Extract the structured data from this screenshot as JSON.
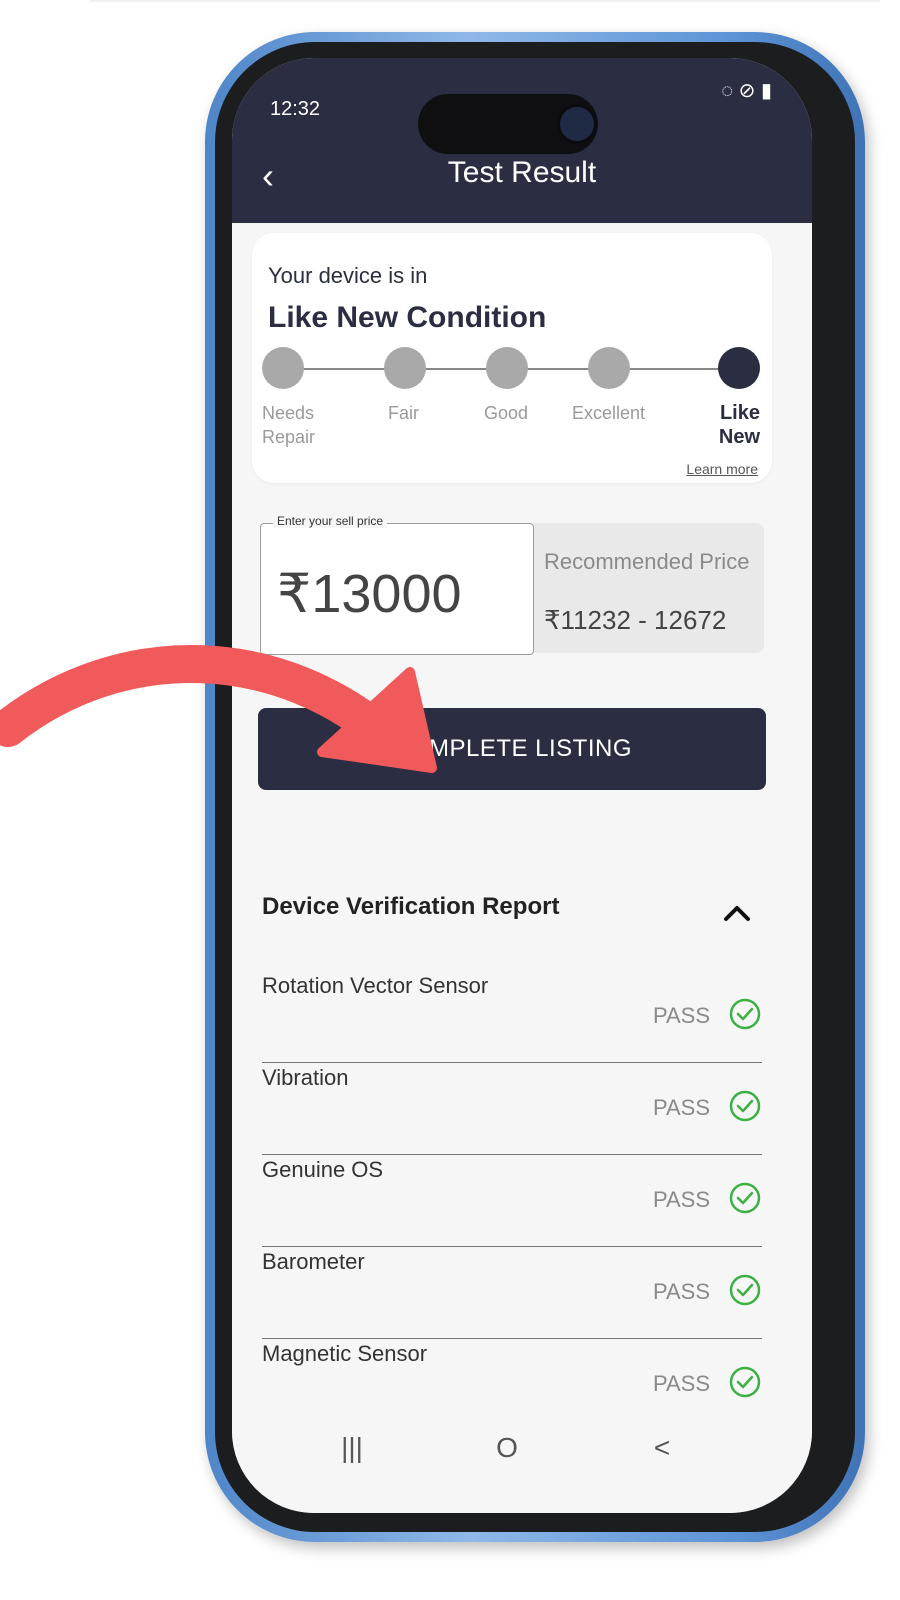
{
  "status_bar": {
    "time": "12:32",
    "icons": "▾ ⚠ •",
    "right_icons": "◌ ⊘ ▮"
  },
  "header": {
    "title": "Test Result"
  },
  "condition": {
    "intro": "Your device is in",
    "headline": "Like New Condition",
    "stages": [
      {
        "label": "Needs Repair"
      },
      {
        "label": "Fair"
      },
      {
        "label": "Good"
      },
      {
        "label": "Excellent"
      },
      {
        "label": "Like New",
        "active": true
      }
    ],
    "learn_more": "Learn more"
  },
  "price": {
    "legend": "Enter your sell price",
    "value": "₹13000",
    "recommended_label": "Recommended Price",
    "recommended_range": "₹11232 - 12672"
  },
  "cta": {
    "label": "COMPLETE LISTING"
  },
  "report": {
    "title": "Device Verification Report",
    "rows": [
      {
        "name": "Rotation Vector Sensor",
        "status": "PASS"
      },
      {
        "name": "Vibration",
        "status": "PASS"
      },
      {
        "name": "Genuine OS",
        "status": "PASS"
      },
      {
        "name": "Barometer",
        "status": "PASS"
      },
      {
        "name": "Magnetic Sensor",
        "status": "PASS"
      }
    ]
  },
  "nav": {
    "recents": "|||",
    "home": "O",
    "back": "<"
  },
  "colors": {
    "primary": "#2b2d42",
    "pass": "#3cb043",
    "arrow": "#f15a5a",
    "frame": "#5d94d6"
  }
}
